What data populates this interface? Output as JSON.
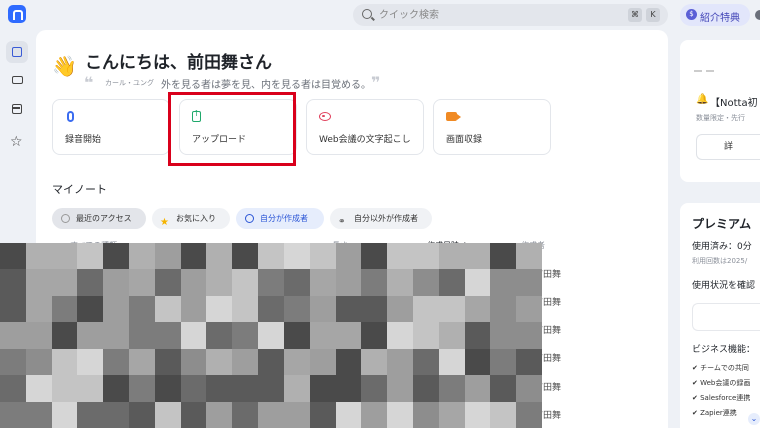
{
  "header": {
    "search_placeholder": "クイック検索",
    "shortcut_keys": [
      "⌘",
      "K"
    ],
    "referral_icon": "$",
    "referral_label": "紹介特典"
  },
  "greeting": {
    "emoji": "👋",
    "text": "こんにちは、前田舞さん",
    "quote_author": "カール・ユング",
    "quote_text": "外を見る者は夢を見、内を見る者は目覚める。",
    "quote_open": "❝",
    "quote_close": "❞"
  },
  "actions": [
    {
      "label": "録音開始",
      "icon": "mic-icon"
    },
    {
      "label": "アップロード",
      "icon": "upload-icon"
    },
    {
      "label": "Web会議の文字起こし",
      "icon": "web-meeting-icon"
    },
    {
      "label": "画面収録",
      "icon": "screen-record-icon"
    }
  ],
  "notes": {
    "title": "マイノート",
    "filters": [
      {
        "label": "最近のアクセス",
        "icon": "clock-icon",
        "state": "selected"
      },
      {
        "label": "お気に入り",
        "icon": "star-icon",
        "state": "normal"
      },
      {
        "label": "自分が作成者",
        "icon": "person-icon",
        "state": "active"
      },
      {
        "label": "自分以外が作成者",
        "icon": "link-icon",
        "state": "normal"
      }
    ],
    "columns": {
      "type": "すべての種類 ⌄",
      "length": "長さ",
      "created": "作成日時 ↓",
      "creator": "作成者"
    },
    "creators": [
      "前田舞",
      "前田舞",
      "前田舞",
      "前田舞",
      "前田舞",
      "前田舞"
    ]
  },
  "promo": {
    "bell": "🔔",
    "title": "【Notta初",
    "subtitle": "数量限定・先行",
    "button": "詳"
  },
  "plan": {
    "title": "プレミアム",
    "used": "使用済み：0分",
    "limit": "利用回数は2025/",
    "check": "使用状況を確認",
    "business": "ビジネス機能：",
    "features": [
      "チームでの共同",
      "Web会議の録画",
      "Salesforce連携",
      "Zapier連携"
    ],
    "scroll_icon": "⌄"
  },
  "colors": {
    "accent": "#2f6bff",
    "highlight_frame": "#d9001b"
  }
}
